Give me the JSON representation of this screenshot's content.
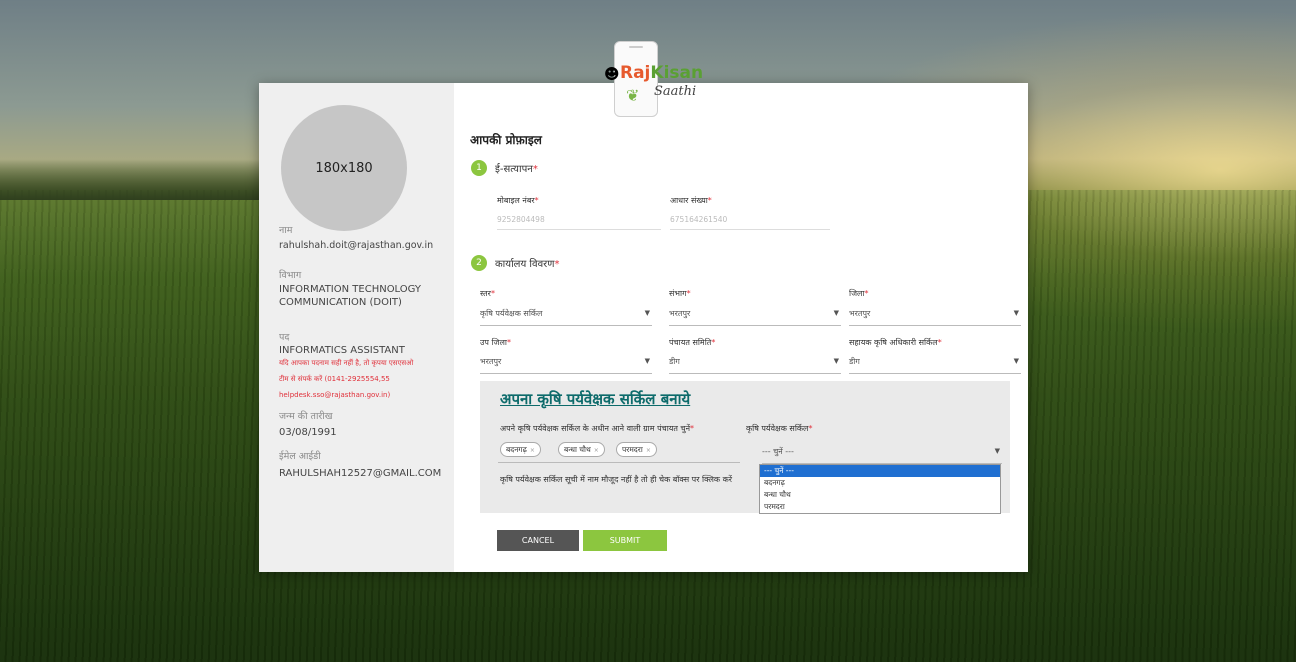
{
  "logo": {
    "brand_a": "Raj",
    "brand_b": "Kisan",
    "sub": "Saathi"
  },
  "sidebar": {
    "avatar_text": "180x180",
    "name_label": "नाम",
    "name_value": "rahulshah.doit@rajasthan.gov.in",
    "dept_label": "विभाग",
    "dept_value": "INFORMATION TECHNOLOGY COMMUNICATION (DOIT)",
    "post_label": "पद",
    "post_value": "INFORMATICS ASSISTANT",
    "post_note_1": "यदि आपका पदनाम सही नहीं है, तो कृपया एसएसओ",
    "post_note_2": "टीम से संपर्क करें (0141-2925554,55",
    "post_note_3": "helpdesk.sso@rajasthan.gov.in)",
    "dob_label": "जन्म की तारीख",
    "dob_value": "03/08/1991",
    "email_label": "ईमेल आईडी",
    "email_value": "RAHULSHAH12527@GMAIL.COM"
  },
  "main": {
    "title": "आपकी प्रोफ़ाइल",
    "step1_num": "1",
    "step1_label": "ई-सत्यापन",
    "mobile_label": "मोबाइल नंबर",
    "mobile_value": "9252804498",
    "aadhaar_label": "आधार संख्या",
    "aadhaar_value": "675164261540",
    "step2_num": "2",
    "step2_label": "कार्यालय विवरण",
    "req": "*",
    "fields": {
      "level_label": "स्तर",
      "level_value": "कृषि पर्यवेक्षक सर्किल",
      "division_label": "संभाग",
      "division_value": "भरतपुर",
      "district_label": "जिला",
      "district_value": "भरतपुर",
      "subdistrict_label": "उप जिला",
      "subdistrict_value": "भरतपुर",
      "panchayat_label": "पंचायत समिति",
      "panchayat_value": "डीग",
      "aao_label": "सहायक कृषि अधिकारी सर्किल",
      "aao_value": "डीग"
    },
    "circle_box": {
      "title": "अपना कृषि पर्यवेक्षक सर्किल बनाये",
      "gp_label": "अपने कृषि पर्यवेक्षक सर्किल के अधीन आने वाली ग्राम पंचायत चुनें",
      "chips": [
        "बदनगढ़",
        "बन्धा चौथ",
        "परमदरा"
      ],
      "chip_x": "×",
      "circle_label": "कृषि पर्यवेक्षक सर्किल",
      "circle_value": "--- चुनें ---",
      "note": "कृषि पर्यवेक्षक सर्किल सूची में नाम मौजूद नहीं है तो ही चेक बॉक्स पर क्लिक करें",
      "options": [
        "--- चुनें ---",
        "बदनगढ़",
        "बन्धा चौथ",
        "परमदरा"
      ]
    },
    "cancel_label": "CANCEL",
    "submit_label": "SUBMIT"
  },
  "colors": {
    "accent_green": "#8cc63f",
    "cancel_gray": "#555555",
    "required_red": "#e0303a",
    "title_teal": "#0d6b6b"
  }
}
